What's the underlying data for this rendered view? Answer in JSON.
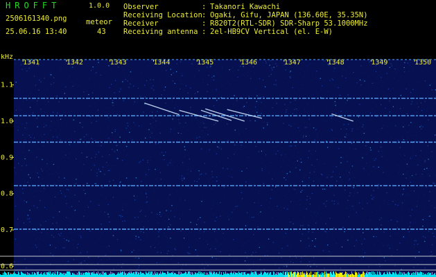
{
  "header": {
    "app_title": "HROFFT",
    "app_version": "1.0.0",
    "filename": "2506161340.png",
    "datetime": "25.06.16 13:40",
    "meteor_label": "meteor",
    "meteor_count": "43"
  },
  "meta": [
    {
      "key": "Observer",
      "value": "Takanori Kawachi"
    },
    {
      "key": "Receiving Location",
      "value": "Ogaki, Gifu, JAPAN (136.60E, 35.35N)"
    },
    {
      "key": "Receiver",
      "value": "R820T2(RTL-SDR) SDR-Sharp 53.1000MHz"
    },
    {
      "key": "Receiving antenna",
      "value": "2el-HB9CV Vertical (el. E-W)"
    }
  ],
  "spectrogram": {
    "y_unit": "kHz",
    "x_ticks": [
      "1341",
      "1342",
      "1343",
      "1344",
      "1345",
      "1346",
      "1347",
      "1348",
      "1349",
      "1350"
    ],
    "y_ticks": [
      "1.1",
      "1.0",
      "0.9",
      "0.8",
      "0.7",
      "0.6"
    ],
    "x_range_min": [
      1340.6,
      1350.3
    ],
    "y_range_khz": [
      0.57,
      1.17
    ],
    "carrier_lines_khz": [
      1.063,
      1.015,
      0.942,
      0.822,
      0.702
    ],
    "meteor_echoes": [
      {
        "t_start": 1343.6,
        "t_end": 1344.4,
        "f_start": 1.05,
        "f_end": 1.018
      },
      {
        "t_start": 1344.4,
        "t_end": 1345.3,
        "f_start": 1.03,
        "f_end": 1.0
      },
      {
        "t_start": 1344.9,
        "t_end": 1345.6,
        "f_start": 1.03,
        "f_end": 1.002
      },
      {
        "t_start": 1345.0,
        "t_end": 1345.9,
        "f_start": 1.034,
        "f_end": 1.0
      },
      {
        "t_start": 1345.5,
        "t_end": 1346.3,
        "f_start": 1.032,
        "f_end": 1.008
      },
      {
        "t_start": 1347.9,
        "t_end": 1348.4,
        "f_start": 1.02,
        "f_end": 1.0
      }
    ],
    "colors": {
      "background": "#000000",
      "noise_low": "#0a1a60",
      "noise_high": "#2c7cd0",
      "carrier": "#5aa8ff",
      "echo": "#cfe8ff",
      "axis_text": "#eeee33",
      "grid": "#e8e8e8",
      "cyan": "#00e0f0"
    }
  }
}
